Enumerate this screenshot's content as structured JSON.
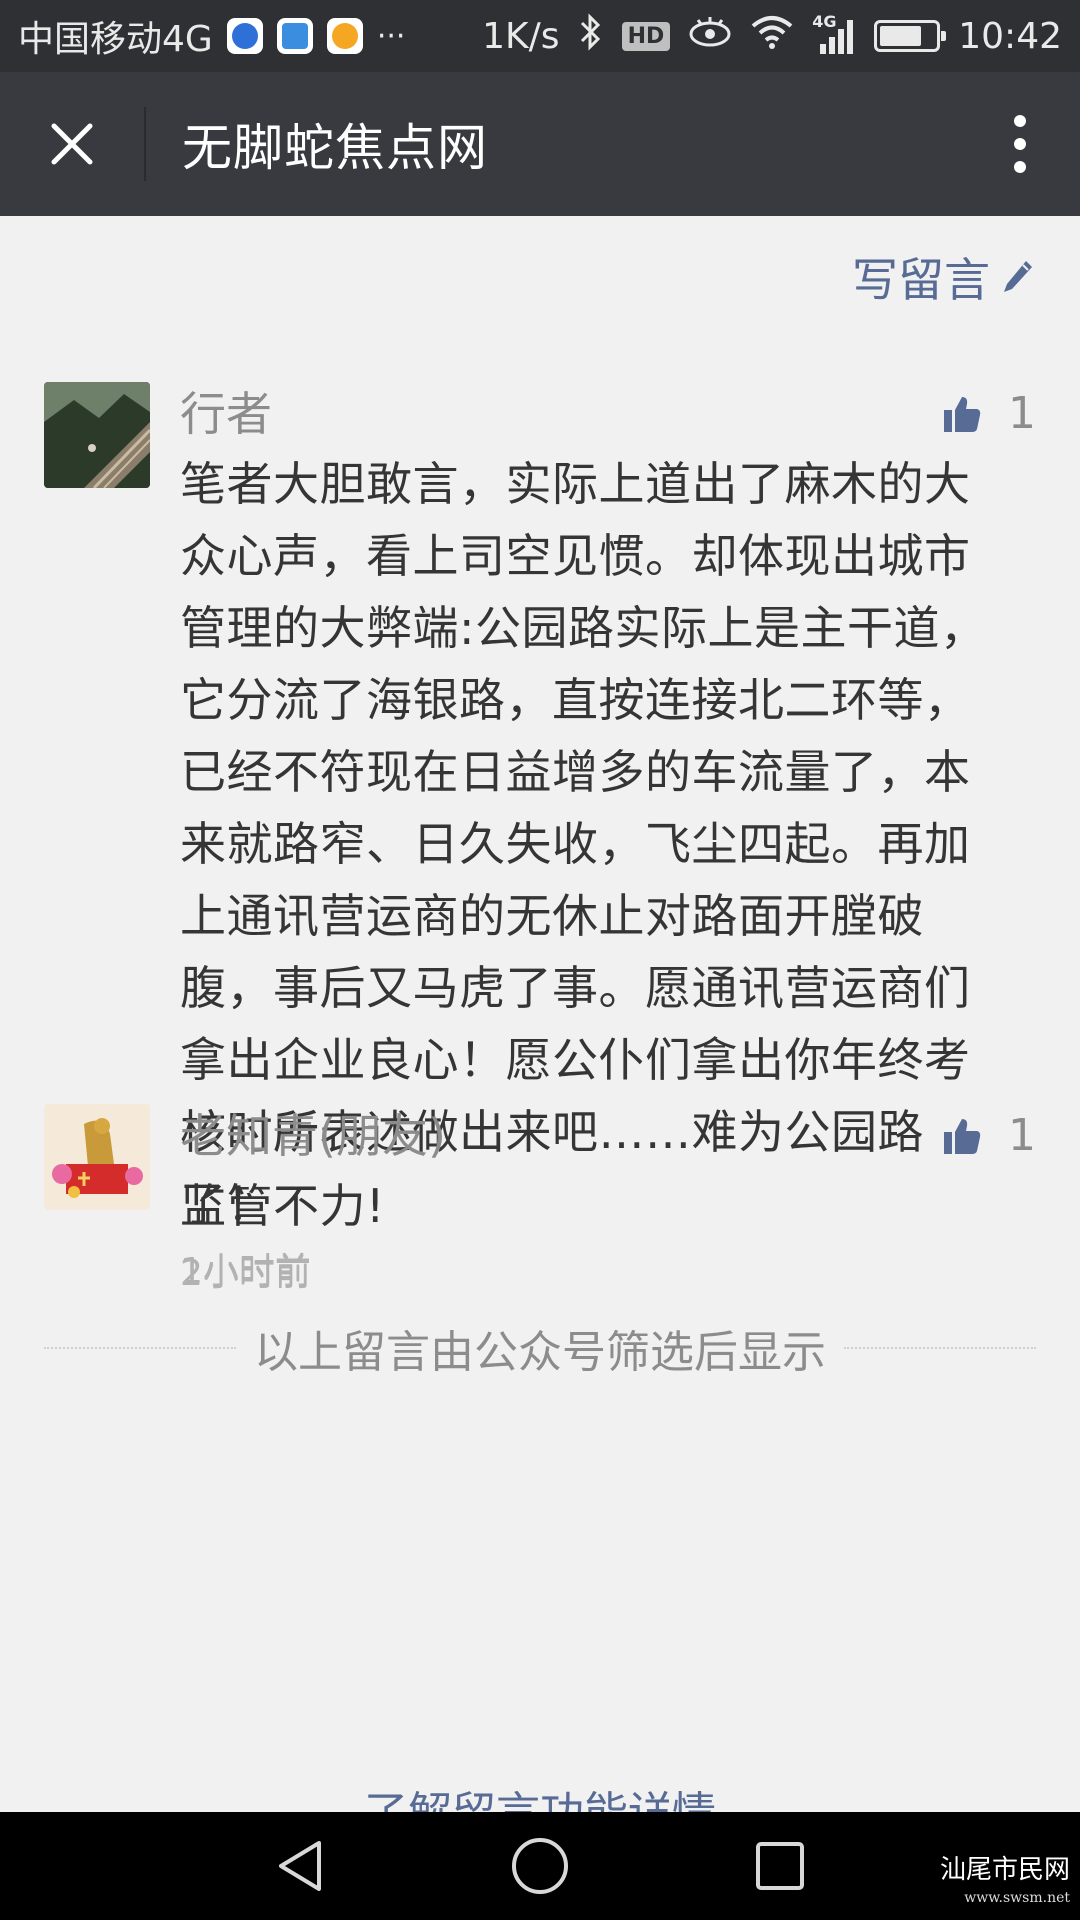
{
  "status_bar": {
    "carrier": "中国移动4G",
    "more": "···",
    "speed": "1K/s",
    "hd": "HD",
    "network": "4G",
    "time": "10:42",
    "battery_level": 0.75,
    "icons": [
      "baidu-app-icon",
      "calendar-app-icon",
      "uc-browser-icon",
      "bluetooth-icon",
      "eye-icon",
      "wifi-icon",
      "signal-icon",
      "battery-icon"
    ]
  },
  "title_bar": {
    "title": "无脚蛇焦点网",
    "close_icon": "close-icon",
    "more_icon": "more-vertical-icon"
  },
  "write_comment": {
    "label": "写留言",
    "icon": "pencil-icon"
  },
  "comments": [
    {
      "nickname": "行者",
      "text": "笔者大胆敢言，实际上道出了麻木的大众心声，看上司空见惯。却体现出城市管理的大弊端:公园路实际上是主干道，它分流了海银路，直按连接北二环等，已经不符现在日益增多的车流量了，本来就路窄、日久失收，飞尘四起。再加上通讯营运商的无休止对路面开膛破腹，事后又马虎了事。愿通讯营运商们拿出企业良心！愿公仆们拿出你年终考核时所表述做出来吧……难为公园路了！",
      "time": "1小时前",
      "likes": "1"
    },
    {
      "nickname": "老知青(朋友)",
      "text": "监管不力!",
      "time": "2小时前",
      "likes": "1"
    }
  ],
  "filter_note": "以上留言由公众号筛选后显示",
  "learn_more": "了解留言功能详情",
  "nav_bar": {
    "icons": [
      "back-icon",
      "home-icon",
      "recents-icon"
    ]
  },
  "watermark": {
    "text": "汕尾市民网",
    "url": "www.swsm.net"
  },
  "colors": {
    "status_bar": "#2e3033",
    "title_bar": "#393a3f",
    "background": "#f1f1f1",
    "link": "#576b95",
    "like_icon": "#576b95"
  }
}
